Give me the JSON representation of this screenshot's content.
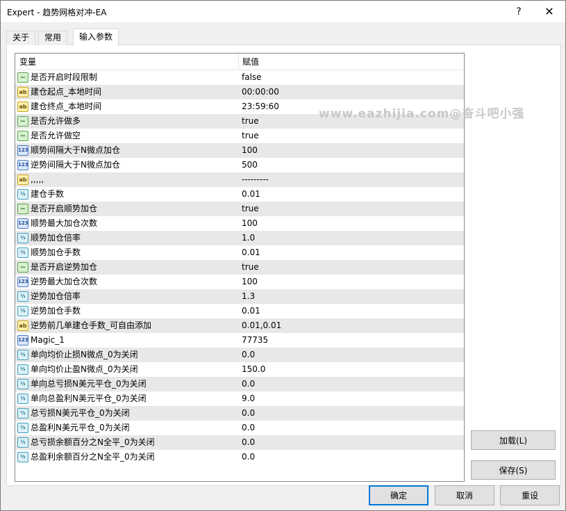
{
  "window": {
    "title": "Expert - 趋势网格对冲-EA",
    "help_label": "?",
    "close_label": "✕"
  },
  "tabs": [
    {
      "label": "关于"
    },
    {
      "label": "常用"
    },
    {
      "label": "输入参数",
      "active": true
    }
  ],
  "grid": {
    "header_variable": "变量",
    "header_value": "赋值",
    "rows": [
      {
        "icon": "bool",
        "name": "是否开启时段限制",
        "value": "false"
      },
      {
        "icon": "str",
        "name": "建仓起点_本地时间",
        "value": "00:00:00"
      },
      {
        "icon": "str",
        "name": "建仓终点_本地时间",
        "value": "23:59:60"
      },
      {
        "icon": "bool",
        "name": "是否允许做多",
        "value": "true"
      },
      {
        "icon": "bool",
        "name": "是否允许做空",
        "value": "true"
      },
      {
        "icon": "int",
        "name": "顺势间隔大于N微点加仓",
        "value": "100"
      },
      {
        "icon": "int",
        "name": "逆势间隔大于N微点加仓",
        "value": "500"
      },
      {
        "icon": "str",
        "name": ",,,,,",
        "value": "---------"
      },
      {
        "icon": "dbl",
        "name": "建仓手数",
        "value": "0.01"
      },
      {
        "icon": "bool",
        "name": "是否开启顺势加仓",
        "value": "true"
      },
      {
        "icon": "int",
        "name": "顺势最大加仓次数",
        "value": "100"
      },
      {
        "icon": "dbl",
        "name": "顺势加仓倍率",
        "value": "1.0"
      },
      {
        "icon": "dbl",
        "name": "顺势加仓手数",
        "value": "0.01"
      },
      {
        "icon": "bool",
        "name": "是否开启逆势加仓",
        "value": "true"
      },
      {
        "icon": "int",
        "name": "逆势最大加仓次数",
        "value": "100"
      },
      {
        "icon": "dbl",
        "name": "逆势加仓倍率",
        "value": "1.3"
      },
      {
        "icon": "dbl",
        "name": "逆势加仓手数",
        "value": "0.01"
      },
      {
        "icon": "str",
        "name": "逆势前几单建仓手数_可自由添加",
        "value": "0.01,0.01"
      },
      {
        "icon": "int",
        "name": "Magic_1",
        "value": "77735"
      },
      {
        "icon": "dbl",
        "name": "单向均价止损N微点_0为关闭",
        "value": "0.0"
      },
      {
        "icon": "dbl",
        "name": "单向均价止盈N微点_0为关闭",
        "value": "150.0"
      },
      {
        "icon": "dbl",
        "name": "单向总亏损N美元平仓_0为关闭",
        "value": "0.0"
      },
      {
        "icon": "dbl",
        "name": "单向总盈利N美元平仓_0为关闭",
        "value": "9.0"
      },
      {
        "icon": "dbl",
        "name": "总亏损N美元平仓_0为关闭",
        "value": "0.0"
      },
      {
        "icon": "dbl",
        "name": "总盈利N美元平仓_0为关闭",
        "value": "0.0"
      },
      {
        "icon": "dbl",
        "name": "总亏损余额百分之N全平_0为关闭",
        "value": "0.0"
      },
      {
        "icon": "dbl",
        "name": "总盈利余额百分之N全平_0为关闭",
        "value": "0.0"
      }
    ]
  },
  "icon_glyphs": {
    "bool": "~",
    "str": "ab",
    "int": "123",
    "dbl": "½"
  },
  "buttons": {
    "load": "加载(L)",
    "save": "保存(S)",
    "ok": "确定",
    "cancel": "取消",
    "reset": "重设"
  },
  "watermark": "www.eazhijia.com@奋斗吧小强"
}
